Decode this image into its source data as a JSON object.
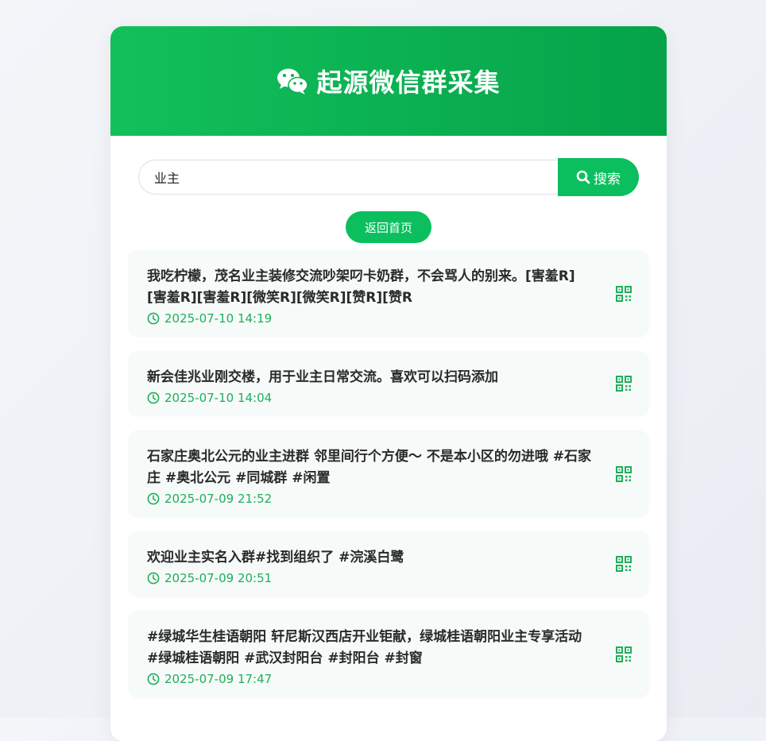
{
  "header": {
    "title": "起源微信群采集",
    "logo_icon": "wechat-icon"
  },
  "search": {
    "value": "业主",
    "button_label": "搜索"
  },
  "home_button": "返回首页",
  "colors": {
    "accent": "#0bbf5f",
    "time": "#1fae5b"
  },
  "results": [
    {
      "title": "我吃柠檬，茂名业主装修交流吵架叼卡奶群，不会骂人的别来。[害羞R][害羞R][害羞R][微笑R][微笑R][赞R][赞R",
      "time": "2025-07-10 14:19"
    },
    {
      "title": "新会佳兆业刚交楼，用于业主日常交流。喜欢可以扫码添加",
      "time": "2025-07-10 14:04"
    },
    {
      "title": "石家庄奥北公元的业主进群 邻里间行个方便～ 不是本小区的勿进哦 #石家庄 #奥北公元 #同城群 #闲置",
      "time": "2025-07-09 21:52"
    },
    {
      "title": "欢迎业主实名入群#找到组织了 #浣溪白鹭",
      "time": "2025-07-09 20:51"
    },
    {
      "title": "#绿城华生桂语朝阳 轩尼斯汉西店开业钜献，绿城桂语朝阳业主专享活动 #绿城桂语朝阳 #武汉封阳台 #封阳台 #封窗",
      "time": "2025-07-09 17:47"
    }
  ]
}
